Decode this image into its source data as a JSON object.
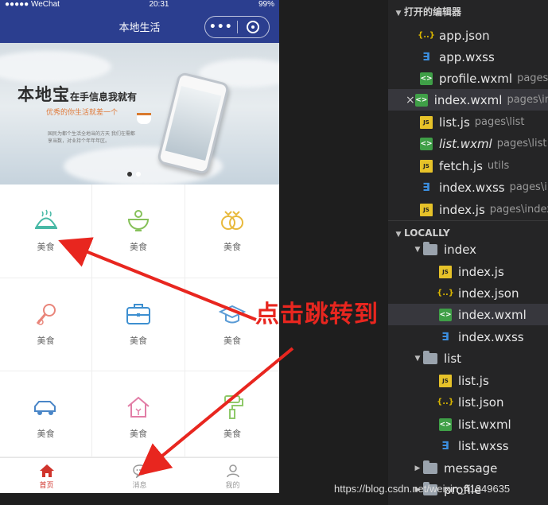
{
  "status_bar": {
    "carrier": "●●●●● WeChat",
    "time": "20:31",
    "battery": "99%"
  },
  "nav": {
    "title": "本地生活",
    "more_glyph": "•••"
  },
  "banner": {
    "title_main": "本地宝",
    "title_small": "在手信息我就有",
    "subtitle": "优秀的你生活就差一个",
    "note": "国民为都个生活全地当的方天 我们在需都享当数，对业持个年年年区。"
  },
  "grid": {
    "items": [
      {
        "label": "美食",
        "icon": "cloche-icon",
        "color": "#49b9a6"
      },
      {
        "label": "美食",
        "icon": "bowl-icon",
        "color": "#86c15a"
      },
      {
        "label": "美食",
        "icon": "rings-icon",
        "color": "#e8b93b"
      },
      {
        "label": "美食",
        "icon": "microphone-icon",
        "color": "#e9857a"
      },
      {
        "label": "美食",
        "icon": "briefcase-icon",
        "color": "#3d8fd0"
      },
      {
        "label": "美食",
        "icon": "graduation-cap-icon",
        "color": "#5a9bd6"
      },
      {
        "label": "美食",
        "icon": "car-icon",
        "color": "#4a86c7"
      },
      {
        "label": "美食",
        "icon": "house-icon",
        "color": "#e27da6"
      },
      {
        "label": "美食",
        "icon": "paint-roller-icon",
        "color": "#8fc96a"
      }
    ]
  },
  "tabbar": {
    "tabs": [
      {
        "label": "首页",
        "icon": "home-icon",
        "active": true
      },
      {
        "label": "消息",
        "icon": "message-icon",
        "active": false
      },
      {
        "label": "我的",
        "icon": "user-icon",
        "active": false
      }
    ]
  },
  "annotation": {
    "text": "点击跳转到",
    "color": "#e8261f"
  },
  "explorer": {
    "open_editors_title": "打开的编辑器",
    "open_editors": [
      {
        "name": "app.json",
        "type": "json",
        "path": ""
      },
      {
        "name": "app.wxss",
        "type": "css",
        "path": ""
      },
      {
        "name": "profile.wxml",
        "type": "wxml",
        "path": "pages\\profile"
      },
      {
        "name": "index.wxml",
        "type": "wxml",
        "path": "pages\\index"
      },
      {
        "name": "list.js",
        "type": "js",
        "path": "pages\\list"
      },
      {
        "name": "list.wxml",
        "type": "wxml",
        "path": "pages\\list"
      },
      {
        "name": "fetch.js",
        "type": "js",
        "path": "utils"
      },
      {
        "name": "index.wxss",
        "type": "css",
        "path": "pages\\index"
      },
      {
        "name": "index.js",
        "type": "js",
        "path": "pages\\index"
      }
    ],
    "locally_title": "LOCALLY",
    "folders": [
      {
        "name": "index",
        "files": [
          "index.js",
          "index.json",
          "index.wxml",
          "index.wxss"
        ]
      },
      {
        "name": "list",
        "files": [
          "list.js",
          "list.json",
          "list.wxml",
          "list.wxss"
        ]
      },
      {
        "name": "message"
      },
      {
        "name": "profile"
      }
    ]
  },
  "watermark": "https://blog.csdn.net/weixin_41349635"
}
